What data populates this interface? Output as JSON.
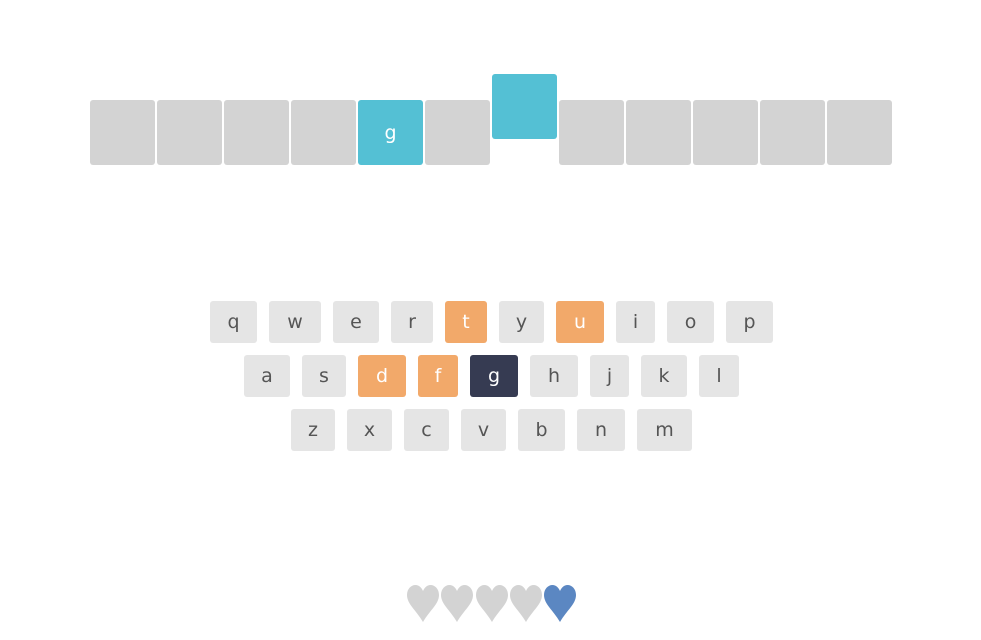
{
  "puzzle": {
    "slots": [
      {
        "letter": "",
        "state": "empty"
      },
      {
        "letter": "",
        "state": "empty"
      },
      {
        "letter": "",
        "state": "empty"
      },
      {
        "letter": "",
        "state": "empty"
      },
      {
        "letter": "g",
        "state": "filled"
      },
      {
        "letter": "",
        "state": "empty"
      },
      {
        "letter": "",
        "state": "active"
      },
      {
        "letter": "",
        "state": "empty"
      },
      {
        "letter": "",
        "state": "empty"
      },
      {
        "letter": "",
        "state": "empty"
      },
      {
        "letter": "",
        "state": "empty"
      },
      {
        "letter": "",
        "state": "empty"
      }
    ]
  },
  "keyboard": {
    "rows": [
      [
        {
          "label": "q",
          "state": "default"
        },
        {
          "label": "w",
          "state": "default"
        },
        {
          "label": "e",
          "state": "default"
        },
        {
          "label": "r",
          "state": "default"
        },
        {
          "label": "t",
          "state": "present"
        },
        {
          "label": "y",
          "state": "default"
        },
        {
          "label": "u",
          "state": "present"
        },
        {
          "label": "i",
          "state": "default"
        },
        {
          "label": "o",
          "state": "default"
        },
        {
          "label": "p",
          "state": "default"
        }
      ],
      [
        {
          "label": "a",
          "state": "default"
        },
        {
          "label": "s",
          "state": "default"
        },
        {
          "label": "d",
          "state": "present"
        },
        {
          "label": "f",
          "state": "present"
        },
        {
          "label": "g",
          "state": "current"
        },
        {
          "label": "h",
          "state": "default"
        },
        {
          "label": "j",
          "state": "default"
        },
        {
          "label": "k",
          "state": "default"
        },
        {
          "label": "l",
          "state": "default"
        }
      ],
      [
        {
          "label": "z",
          "state": "default"
        },
        {
          "label": "x",
          "state": "default"
        },
        {
          "label": "c",
          "state": "default"
        },
        {
          "label": "v",
          "state": "default"
        },
        {
          "label": "b",
          "state": "default"
        },
        {
          "label": "n",
          "state": "default"
        },
        {
          "label": "m",
          "state": "default"
        }
      ]
    ]
  },
  "lives": {
    "total": 5,
    "remaining": 1,
    "colors": {
      "active": "#5b87c2",
      "lost": "#d3d3d3"
    }
  },
  "colors": {
    "slot_empty": "#d3d3d3",
    "slot_filled": "#54c0d4",
    "key_default": "#e5e5e5",
    "key_present": "#f2a96a",
    "key_current": "#363b52"
  }
}
